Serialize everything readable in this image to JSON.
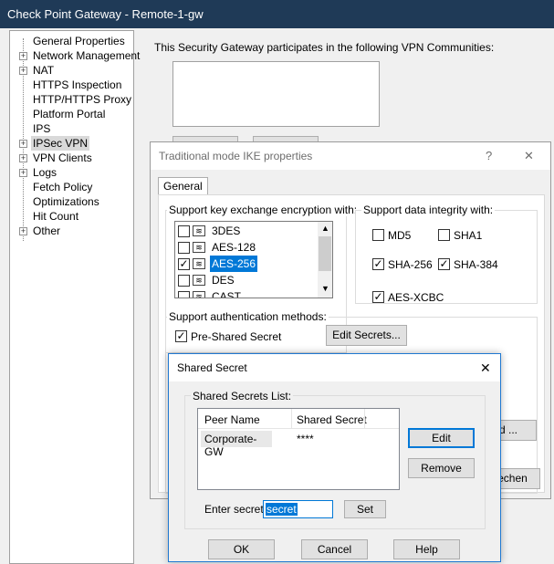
{
  "window": {
    "title": "Check Point Gateway - Remote-1-gw"
  },
  "tree": {
    "items": [
      {
        "label": "General Properties",
        "expandable": false
      },
      {
        "label": "Network Management",
        "expandable": true
      },
      {
        "label": "NAT",
        "expandable": true
      },
      {
        "label": "HTTPS Inspection",
        "expandable": false
      },
      {
        "label": "HTTP/HTTPS Proxy",
        "expandable": false
      },
      {
        "label": "Platform Portal",
        "expandable": false
      },
      {
        "label": "IPS",
        "expandable": false
      },
      {
        "label": "IPSec VPN",
        "expandable": true,
        "selected": true
      },
      {
        "label": "VPN Clients",
        "expandable": true
      },
      {
        "label": "Logs",
        "expandable": true
      },
      {
        "label": "Fetch Policy",
        "expandable": false
      },
      {
        "label": "Optimizations",
        "expandable": false
      },
      {
        "label": "Hit Count",
        "expandable": false
      },
      {
        "label": "Other",
        "expandable": true
      }
    ]
  },
  "main": {
    "communities_text": "This Security Gateway participates in the following VPN Communities:"
  },
  "ike_dialog": {
    "title": "Traditional mode IKE properties",
    "help": "?",
    "close": "✕",
    "tab": "General",
    "encryption_group": "Support key exchange encryption with:",
    "encryption_items": [
      {
        "label": "3DES",
        "checked": false,
        "selected": false
      },
      {
        "label": "AES-128",
        "checked": false,
        "selected": false
      },
      {
        "label": "AES-256",
        "checked": true,
        "selected": true
      },
      {
        "label": "DES",
        "checked": false,
        "selected": false
      },
      {
        "label": "CAST",
        "checked": false,
        "selected": false
      }
    ],
    "integrity_group": "Support data integrity with:",
    "integrity_items": [
      {
        "label": "MD5",
        "checked": false
      },
      {
        "label": "SHA1",
        "checked": false
      },
      {
        "label": "SHA-256",
        "checked": true
      },
      {
        "label": "SHA-384",
        "checked": true
      },
      {
        "label": "AES-XCBC",
        "checked": true
      }
    ],
    "auth_group": "Support authentication methods:",
    "preshared_label": "Pre-Shared Secret",
    "preshared_checked": true,
    "edit_secrets_button": "Edit Secrets...",
    "partial_button_1": "d ...",
    "partial_button_2": "rechen"
  },
  "shared_secret_dialog": {
    "title": "Shared Secret",
    "close": "✕",
    "list_group": "Shared Secrets List:",
    "columns": [
      "Peer Name",
      "Shared Secret"
    ],
    "rows": [
      {
        "peer": "Corporate-GW",
        "secret": "****"
      }
    ],
    "edit_button": "Edit",
    "remove_button": "Remove",
    "enter_secret_label": "Enter secret:",
    "enter_secret_value": "secret",
    "set_button": "Set",
    "ok_button": "OK",
    "cancel_button": "Cancel",
    "help_button": "Help"
  },
  "colors": {
    "titlebar": "#1f3a57",
    "selection": "#0078d7",
    "focus_border": "#1f78d1"
  }
}
